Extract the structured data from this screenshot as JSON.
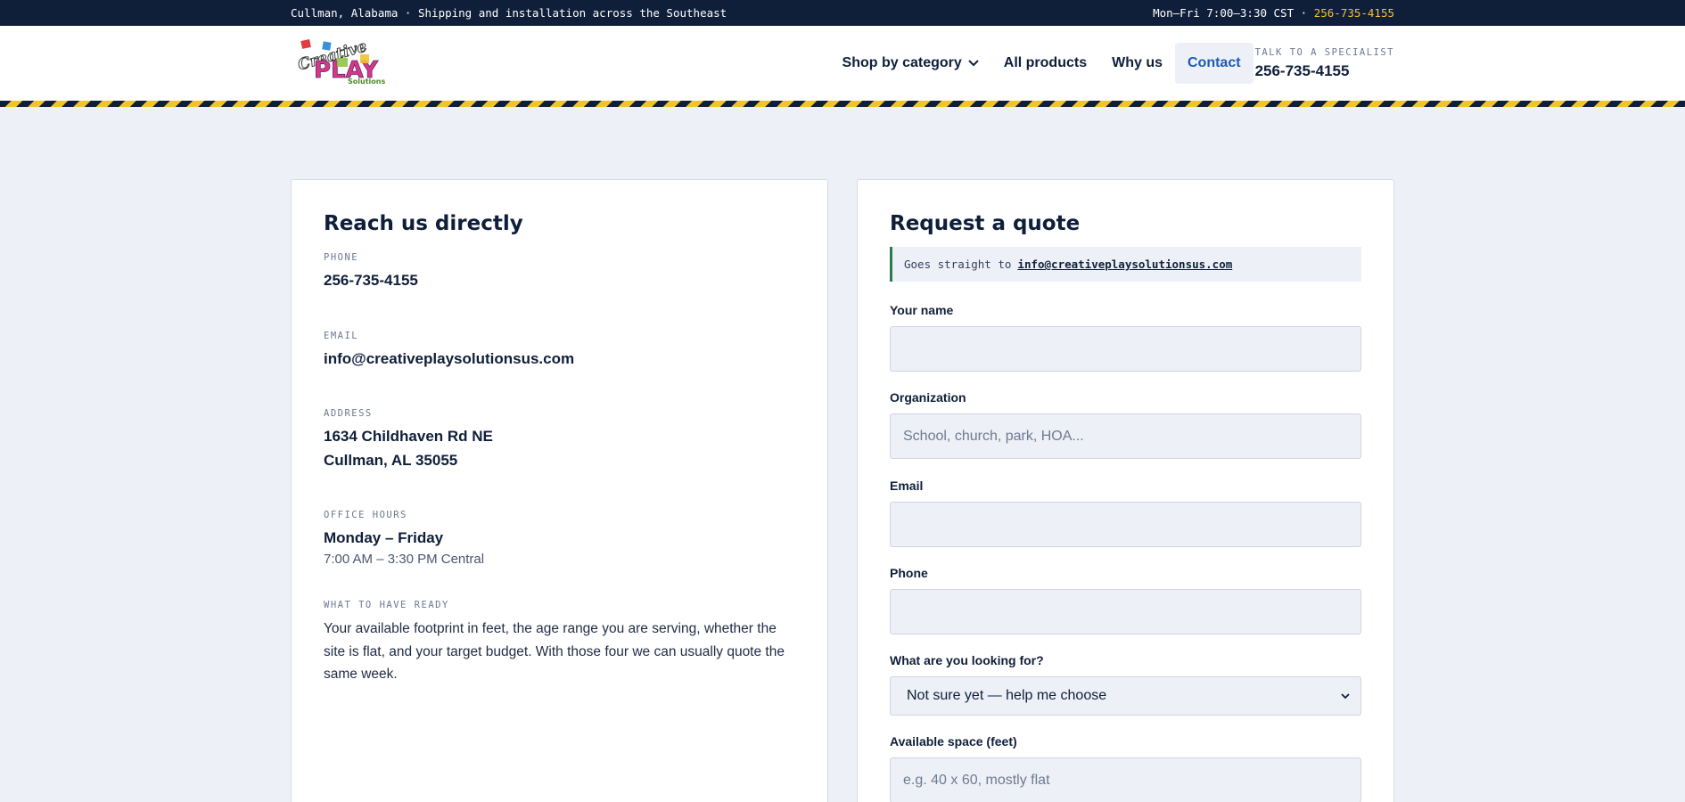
{
  "topbar": {
    "location": "Cullman, Alabama · Shipping and installation across the Southeast",
    "hours": "Mon–Fri 7:00–3:30 CST ·",
    "phone": "256-735-4155"
  },
  "header": {
    "logo_text_1": "Creative",
    "logo_text_2": "PLAY",
    "logo_text_3": "Solutions",
    "nav": {
      "shop": "Shop by category",
      "all": "All products",
      "why": "Why us",
      "contact": "Contact"
    },
    "specialist_label": "TALK TO A SPECIALIST",
    "specialist_phone": "256-735-4155"
  },
  "direct": {
    "title": "Reach us directly",
    "phone_label": "PHONE",
    "phone": "256-735-4155",
    "email_label": "EMAIL",
    "email": "info@creativeplaysolutionsus.com",
    "address_label": "ADDRESS",
    "address_line1": "1634 Childhaven Rd NE",
    "address_line2": "Cullman, AL 35055",
    "hours_label": "OFFICE HOURS",
    "hours_days": "Monday – Friday",
    "hours_time": "7:00 AM – 3:30 PM Central",
    "ready_label": "WHAT TO HAVE READY",
    "ready_text": "Your available footprint in feet, the age range you are serving, whether the site is flat, and your target budget. With those four we can usually quote the same week."
  },
  "quote": {
    "title": "Request a quote",
    "notice_prefix": "Goes straight to",
    "notice_email": "info@creativeplaysolutionsus.com",
    "name_label": "Your name",
    "name_value": "",
    "org_label": "Organization",
    "org_placeholder": "School, church, park, HOA...",
    "email_label": "Email",
    "email_value": "",
    "phone_label": "Phone",
    "phone_value": "",
    "looking_label": "What are you looking for?",
    "looking_selected": "Not sure yet — help me choose",
    "space_label": "Available space (feet)",
    "space_placeholder": "e.g. 40 x 60, mostly flat"
  },
  "colors": {
    "navy": "#0f1f3a",
    "accent_yellow": "#f2c230",
    "link_blue": "#1e5ab4",
    "notice_green": "#2a7a4b",
    "page_bg": "#edf1f7"
  }
}
